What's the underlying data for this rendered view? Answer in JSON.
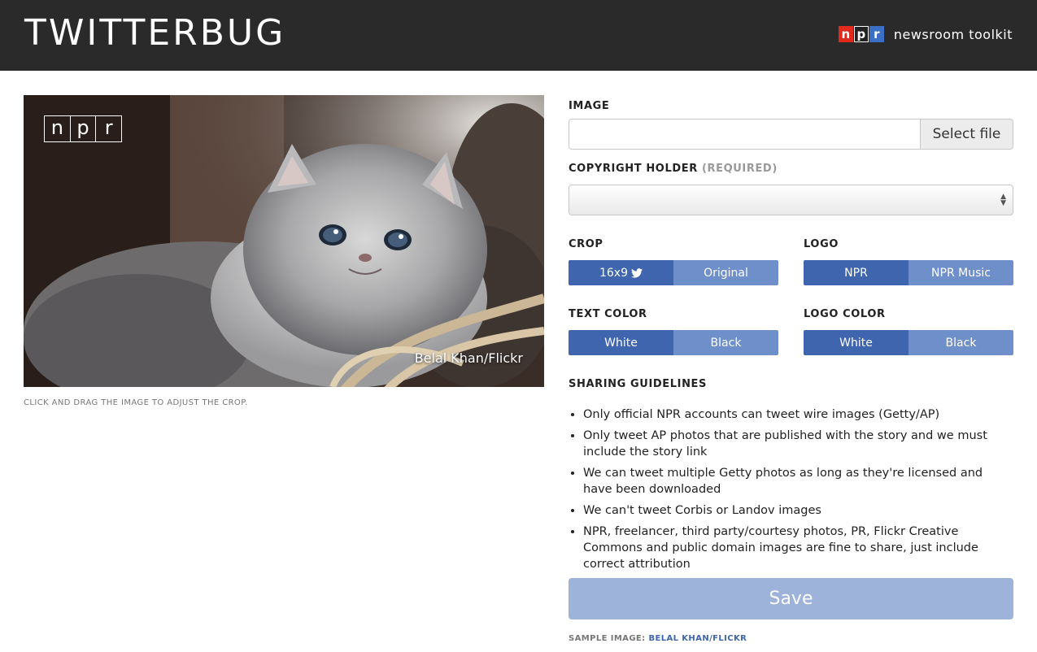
{
  "header": {
    "title": "TWITTERBUG",
    "brand_logo_letters": [
      "n",
      "p",
      "r"
    ],
    "brand_text": "newsroom toolkit"
  },
  "preview": {
    "logo_letters": [
      "n",
      "p",
      "r"
    ],
    "credit": "Belal Khan/Flickr",
    "caption": "CLICK AND DRAG THE IMAGE TO ADJUST THE CROP."
  },
  "form": {
    "image_label": "IMAGE",
    "file_button": "Select file",
    "copyright_label": "COPYRIGHT HOLDER",
    "copyright_required": "(REQUIRED)",
    "crop": {
      "label": "CROP",
      "options": [
        "16x9",
        "Original"
      ],
      "selected": "16x9"
    },
    "logo": {
      "label": "LOGO",
      "options": [
        "NPR",
        "NPR Music"
      ],
      "selected": "NPR"
    },
    "text_color": {
      "label": "TEXT COLOR",
      "options": [
        "White",
        "Black"
      ],
      "selected": "White"
    },
    "logo_color": {
      "label": "LOGO COLOR",
      "options": [
        "White",
        "Black"
      ],
      "selected": "White"
    },
    "guidelines_label": "SHARING GUIDELINES",
    "guidelines": [
      "Only official NPR accounts can tweet wire images (Getty/AP)",
      "Only tweet AP photos that are published with the story and we must include the story link",
      "We can tweet multiple Getty photos as long as they're licensed and have been downloaded",
      "We can't tweet Corbis or Landov images",
      "NPR, freelancer, third party/courtesy photos, PR, Flickr Creative Commons and public domain images are fine to share, just include correct attribution"
    ],
    "save_label": "Save",
    "sample_prefix": "SAMPLE IMAGE:",
    "sample_link": "BELAL KHAN/FLICKR"
  },
  "colors": {
    "header_bg": "#2a2a2a",
    "toggle_selected": "#3e65ad",
    "toggle_unselected": "#6f8fcb",
    "save_disabled": "#9db3d9",
    "npr_red": "#e02a1c",
    "npr_blue": "#3b6fc5"
  },
  "icons": {
    "crop_16x9": "twitter-bird-icon"
  }
}
